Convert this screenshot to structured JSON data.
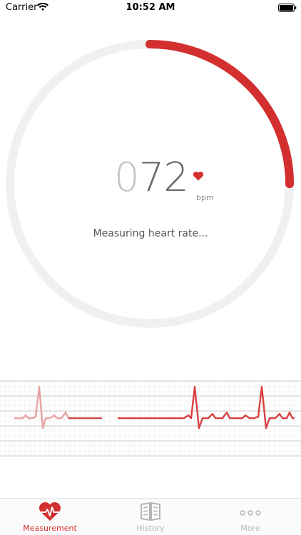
{
  "status_bar": {
    "carrier": "Carrier",
    "time": "10:52 AM",
    "icons": [
      "wifi-icon",
      "battery-icon"
    ]
  },
  "measurement": {
    "bpm_lead": "0",
    "bpm_value": "72",
    "bpm_unit": "bpm",
    "status": "Measuring heart rate...",
    "progress": 0.25
  },
  "tabs": [
    {
      "label": "Measurement",
      "icon": "heart-pulse-icon",
      "active": true
    },
    {
      "label": "History",
      "icon": "book-icon",
      "active": false
    },
    {
      "label": "More",
      "icon": "more-dots-icon",
      "active": false
    }
  ],
  "colors": {
    "accent": "#d32f2f",
    "track": "#f0f0f0",
    "inactive": "#b5b5b5",
    "ecg_faded": "#e8a3a3"
  }
}
